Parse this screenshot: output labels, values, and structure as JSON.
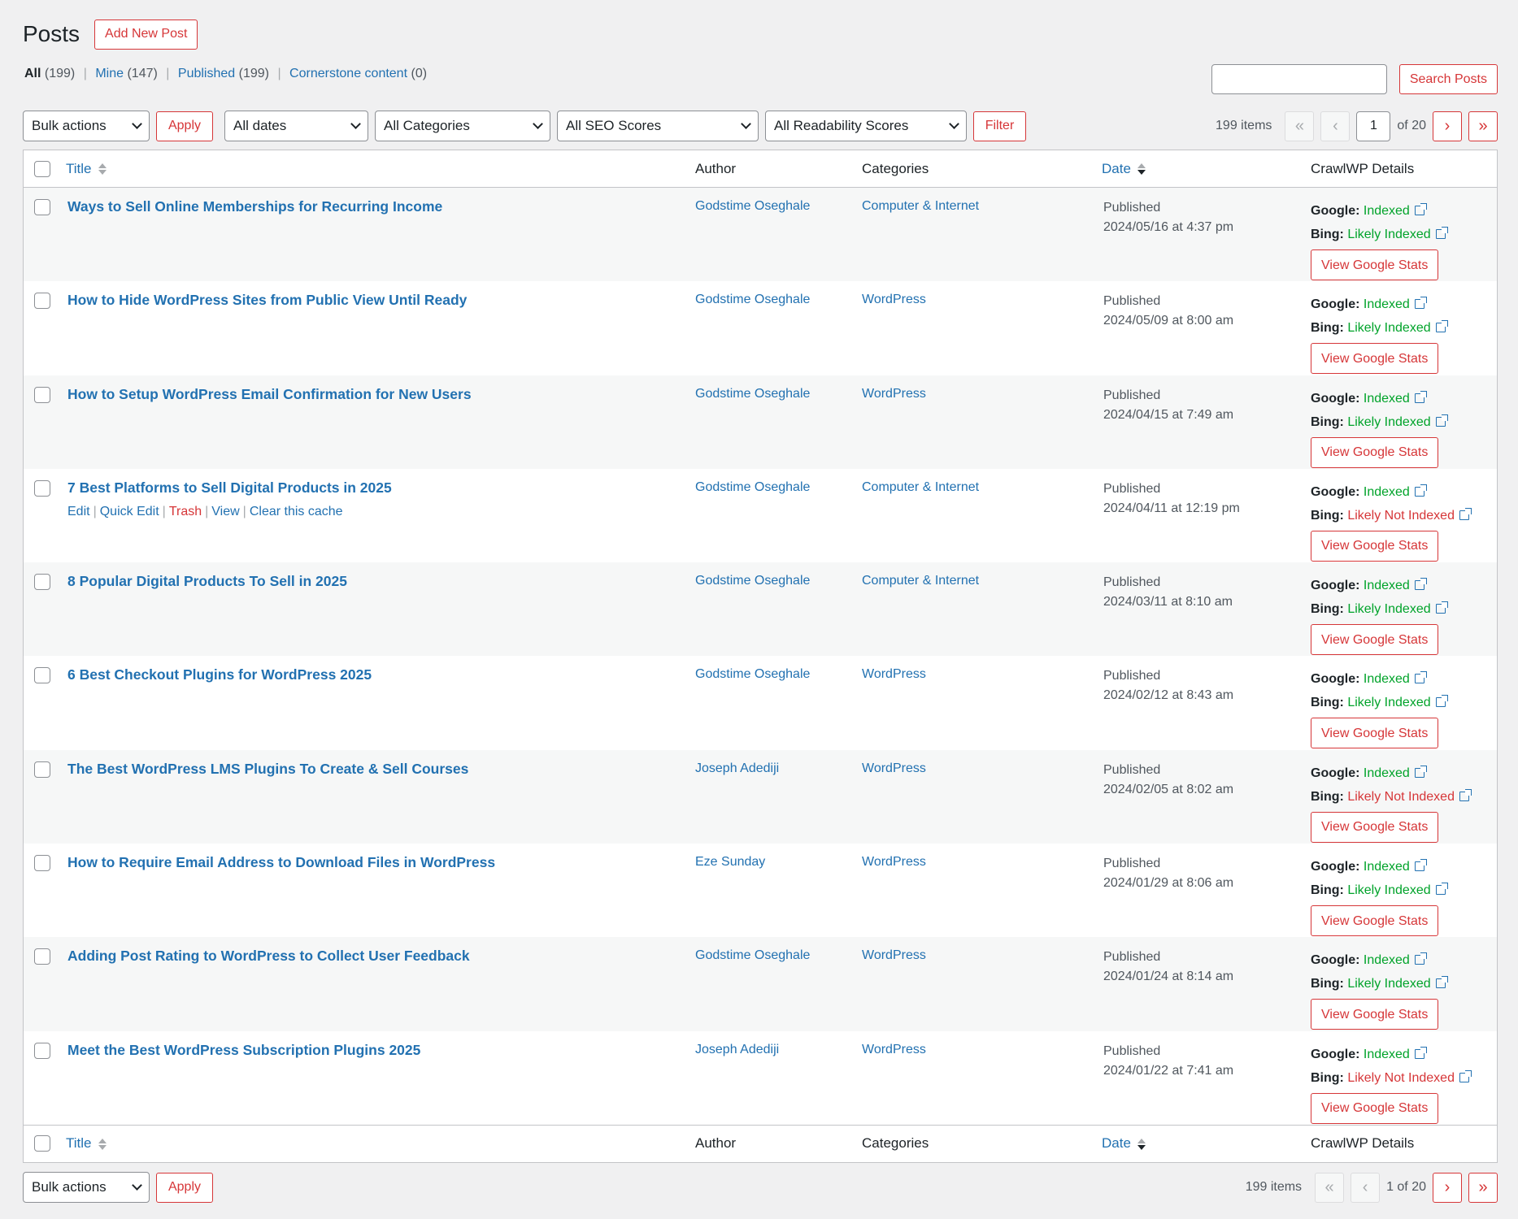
{
  "header": {
    "title": "Posts",
    "add_new_label": "Add New Post"
  },
  "views": {
    "all_label": "All",
    "all_count": "(199)",
    "mine_label": "Mine",
    "mine_count": "(147)",
    "published_label": "Published",
    "published_count": "(199)",
    "cornerstone_label": "Cornerstone content",
    "cornerstone_count": "(0)"
  },
  "search": {
    "value": "",
    "button_label": "Search Posts"
  },
  "filters": {
    "bulk_actions": "Bulk actions",
    "apply_label": "Apply",
    "dates": "All dates",
    "categories": "All Categories",
    "seo_scores": "All SEO Scores",
    "readability_scores": "All Readability Scores",
    "filter_label": "Filter"
  },
  "pagination": {
    "items": "199 items",
    "first": "«",
    "prev": "‹",
    "next": "›",
    "last": "»",
    "current_page": "1",
    "of_total": "of 20",
    "bottom_text": "1 of 20"
  },
  "columns": {
    "title": "Title",
    "author": "Author",
    "categories": "Categories",
    "date": "Date",
    "crawlwp": "CrawlWP Details"
  },
  "crawl_labels": {
    "google": "Google:",
    "bing": "Bing:",
    "stats_button": "View Google Stats"
  },
  "row_actions": {
    "edit": "Edit",
    "quick_edit": "Quick Edit",
    "trash": "Trash",
    "view": "View",
    "clear_cache": "Clear this cache"
  },
  "posts": [
    {
      "title": "Ways to Sell Online Memberships for Recurring Income",
      "author": "Godstime Oseghale",
      "category": "Computer & Internet",
      "status": "Published",
      "date": "2024/05/16 at 4:37 pm",
      "google": "Indexed",
      "bing": "Likely Indexed",
      "bing_ok": true
    },
    {
      "title": "How to Hide WordPress Sites from Public View Until Ready",
      "author": "Godstime Oseghale",
      "category": "WordPress",
      "status": "Published",
      "date": "2024/05/09 at 8:00 am",
      "google": "Indexed",
      "bing": "Likely Indexed",
      "bing_ok": true
    },
    {
      "title": "How to Setup WordPress Email Confirmation for New Users",
      "author": "Godstime Oseghale",
      "category": "WordPress",
      "status": "Published",
      "date": "2024/04/15 at 7:49 am",
      "google": "Indexed",
      "bing": "Likely Indexed",
      "bing_ok": true
    },
    {
      "title": "7 Best Platforms to Sell Digital Products in 2025",
      "author": "Godstime Oseghale",
      "category": "Computer & Internet",
      "status": "Published",
      "date": "2024/04/11 at 12:19 pm",
      "google": "Indexed",
      "bing": "Likely Not Indexed",
      "bing_ok": false,
      "show_actions": true
    },
    {
      "title": "8 Popular Digital Products To Sell in 2025",
      "author": "Godstime Oseghale",
      "category": "Computer & Internet",
      "status": "Published",
      "date": "2024/03/11 at 8:10 am",
      "google": "Indexed",
      "bing": "Likely Indexed",
      "bing_ok": true
    },
    {
      "title": "6 Best Checkout Plugins for WordPress 2025",
      "author": "Godstime Oseghale",
      "category": "WordPress",
      "status": "Published",
      "date": "2024/02/12 at 8:43 am",
      "google": "Indexed",
      "bing": "Likely Indexed",
      "bing_ok": true
    },
    {
      "title": "The Best WordPress LMS Plugins To Create & Sell Courses",
      "author": "Joseph Adediji",
      "category": "WordPress",
      "status": "Published",
      "date": "2024/02/05 at 8:02 am",
      "google": "Indexed",
      "bing": "Likely Not Indexed",
      "bing_ok": false
    },
    {
      "title": "How to Require Email Address to Download Files in WordPress",
      "author": "Eze Sunday",
      "category": "WordPress",
      "status": "Published",
      "date": "2024/01/29 at 8:06 am",
      "google": "Indexed",
      "bing": "Likely Indexed",
      "bing_ok": true
    },
    {
      "title": "Adding Post Rating to WordPress to Collect User Feedback",
      "author": "Godstime Oseghale",
      "category": "WordPress",
      "status": "Published",
      "date": "2024/01/24 at 8:14 am",
      "google": "Indexed",
      "bing": "Likely Indexed",
      "bing_ok": true
    },
    {
      "title": "Meet the Best WordPress Subscription Plugins 2025",
      "author": "Joseph Adediji",
      "category": "WordPress",
      "status": "Published",
      "date": "2024/01/22 at 7:41 am",
      "google": "Indexed",
      "bing": "Likely Not Indexed",
      "bing_ok": false
    }
  ]
}
